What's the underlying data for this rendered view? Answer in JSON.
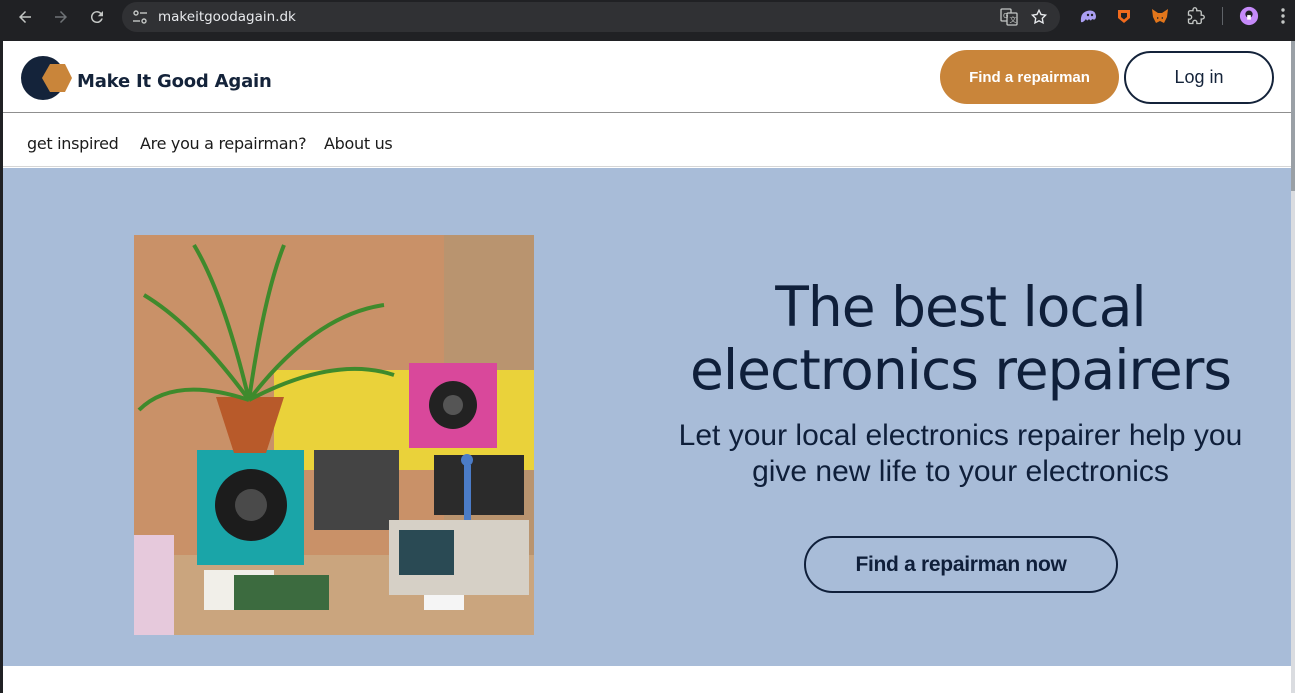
{
  "browser": {
    "url": "makeitgoodagain.dk",
    "icons": [
      "back-icon",
      "forward-icon",
      "reload-icon",
      "site-info-icon",
      "translate-icon",
      "bookmark-star-icon",
      "extension-ghost-icon",
      "extension-brave-icon",
      "extension-metamask-icon",
      "extensions-puzzle-icon",
      "profile-avatar",
      "menu-kebab-icon"
    ]
  },
  "header": {
    "brand": "Make It Good Again",
    "find_button": "Find a repairman",
    "login_button": "Log in"
  },
  "nav": {
    "items": [
      "get inspired",
      "Are you a repairman?",
      "About us"
    ]
  },
  "hero": {
    "headline_line1": "The best local",
    "headline_line2": "electronics repairers",
    "subtitle_line1": "Let your local electronics repairer help you",
    "subtitle_line2": "give new life to your electronics",
    "cta": "Find a repairman now"
  },
  "colors": {
    "accent": "#c9853a",
    "navy": "#14233a",
    "hero_bg": "#a8bcd8"
  }
}
